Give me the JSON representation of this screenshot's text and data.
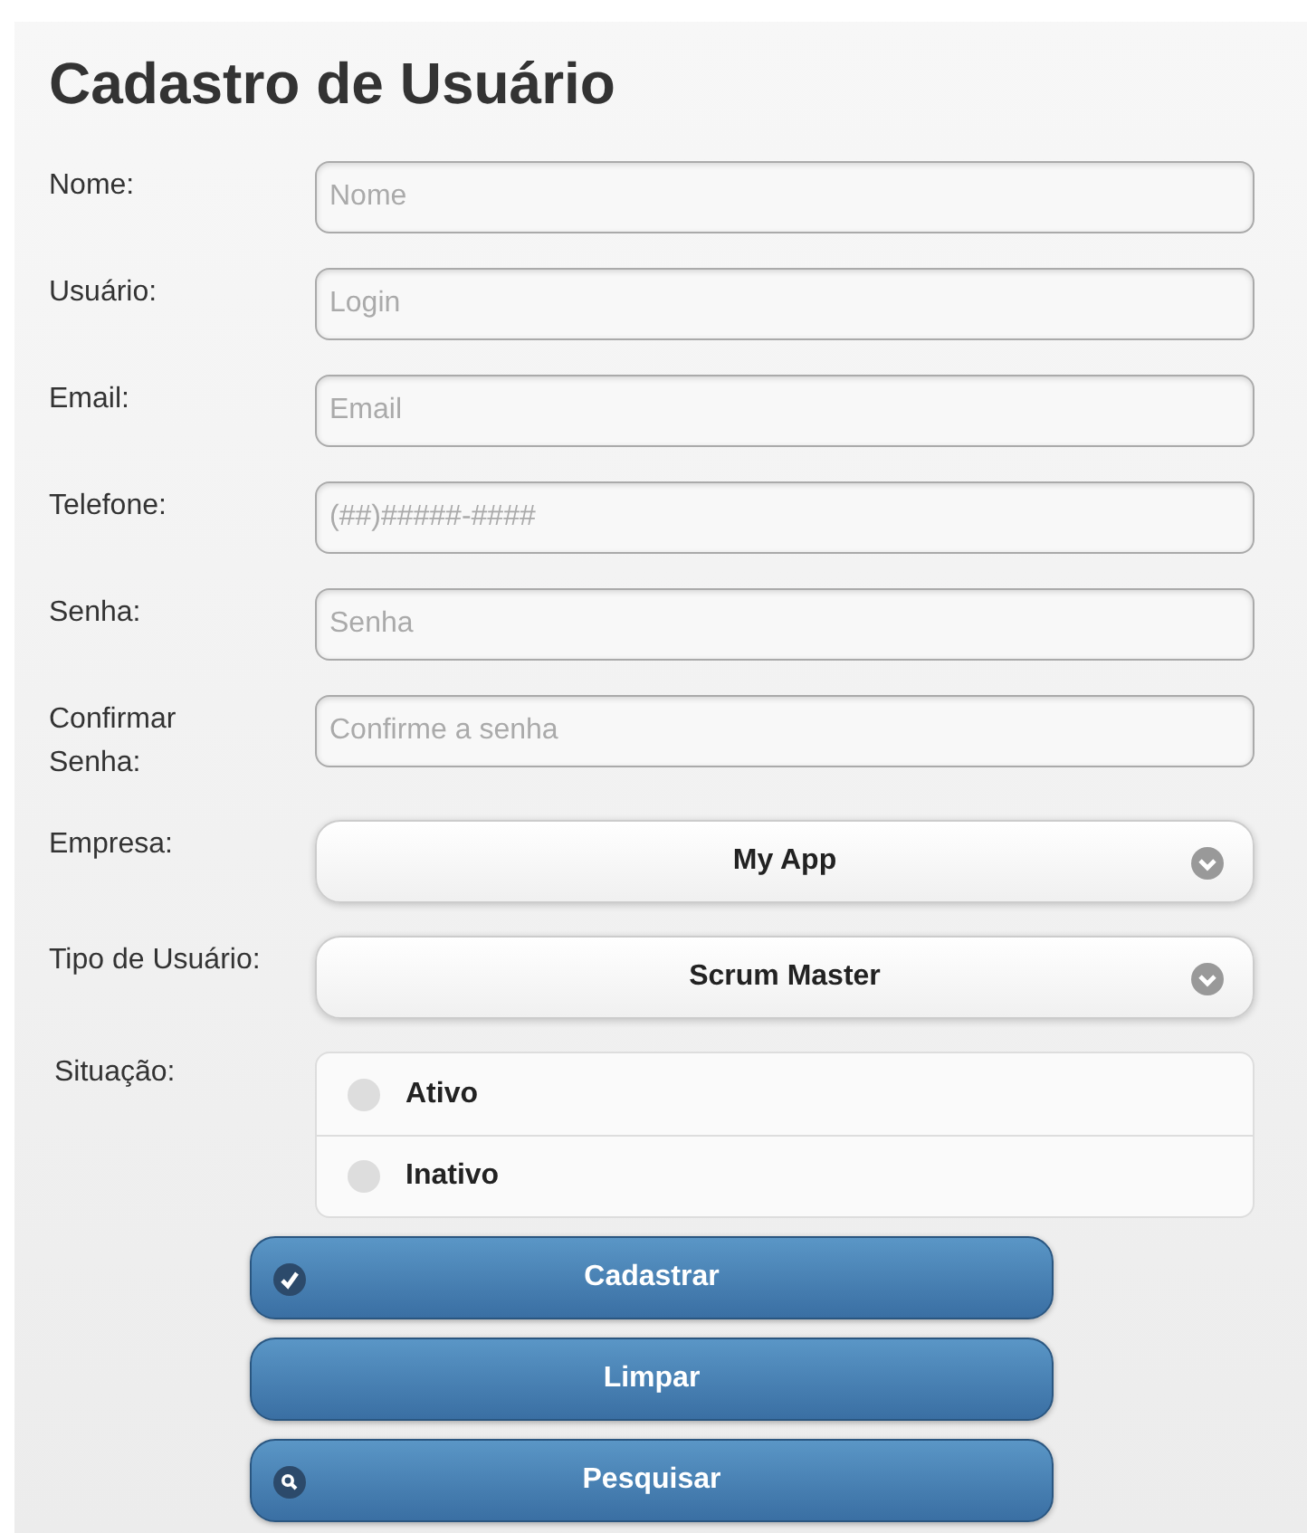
{
  "title": "Cadastro de Usuário",
  "fields": [
    {
      "kind": "text",
      "label": "Nome:",
      "placeholder": "Nome"
    },
    {
      "kind": "text",
      "label": "Usuário:",
      "placeholder": "Login"
    },
    {
      "kind": "text",
      "label": "Email:",
      "placeholder": "Email"
    },
    {
      "kind": "text",
      "label": "Telefone:",
      "placeholder": "(##)#####-####"
    },
    {
      "kind": "text",
      "label": "Senha:",
      "placeholder": "Senha"
    },
    {
      "kind": "text",
      "label": "Confirmar Senha:",
      "placeholder": "Confirme a senha"
    },
    {
      "kind": "select",
      "label": "Empresa:",
      "value": "My App"
    },
    {
      "kind": "select",
      "label": "Tipo de Usuário:",
      "value": "Scrum Master"
    },
    {
      "kind": "radio",
      "label": "Situação:",
      "options": [
        {
          "label": "Ativo",
          "selected": false
        },
        {
          "label": "Inativo",
          "selected": false
        }
      ]
    }
  ],
  "buttons": [
    {
      "label": "Cadastrar",
      "kind": "check"
    },
    {
      "label": "Limpar",
      "kind": "plain"
    },
    {
      "label": "Pesquisar",
      "kind": "search"
    }
  ]
}
